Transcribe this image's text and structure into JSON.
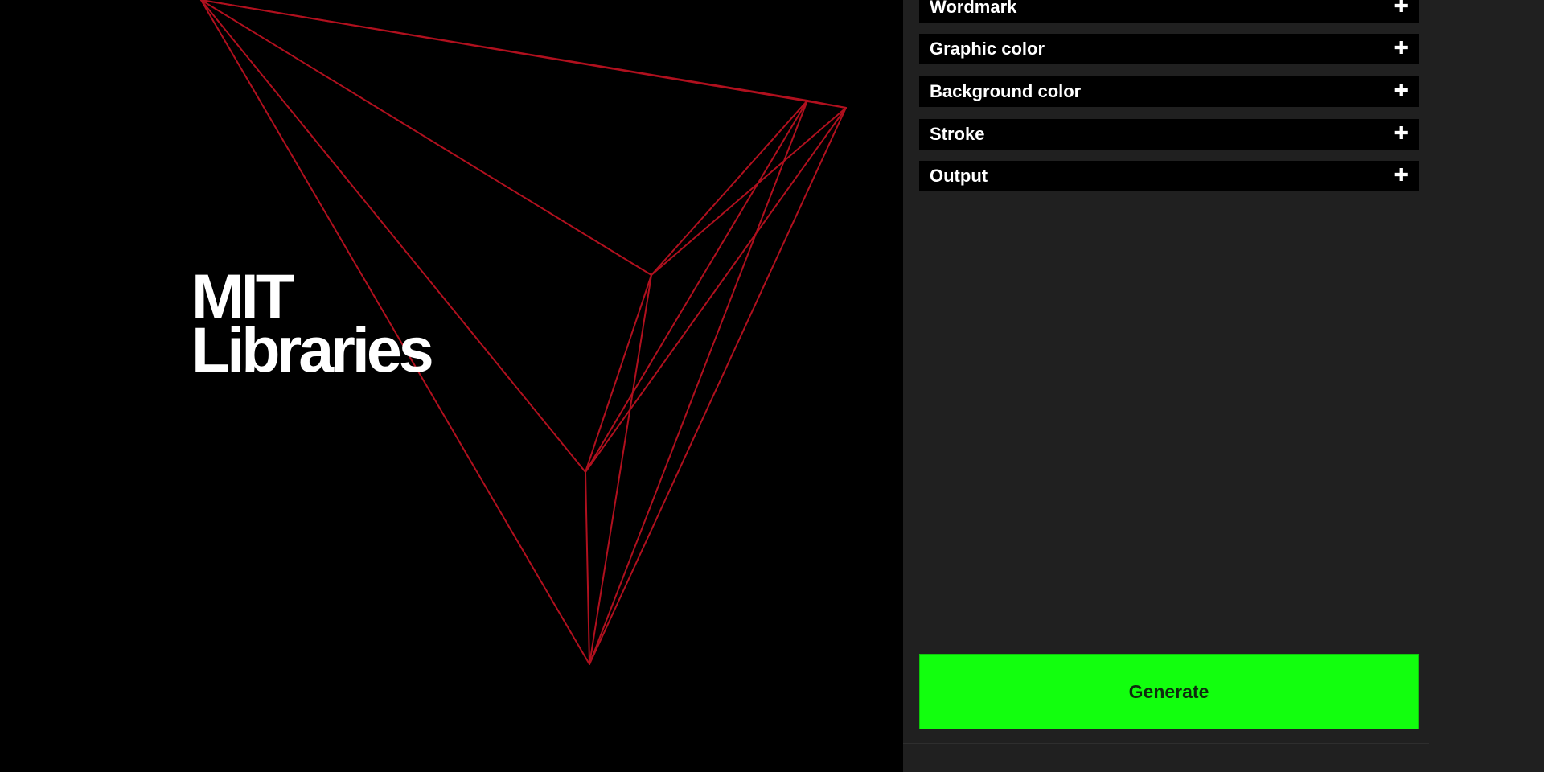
{
  "colors": {
    "canvas_background": "#000000",
    "graphic_stroke": "#b0101e",
    "panel_background": "#202020",
    "accordion_background": "#000000",
    "generate_button": "#12ff0e"
  },
  "wordmark": {
    "line1": "MIT",
    "line2": "Libraries"
  },
  "panel": {
    "sections": [
      {
        "label": "Wordmark",
        "icon": "plus-icon"
      },
      {
        "label": "Graphic color",
        "icon": "plus-icon"
      },
      {
        "label": "Background color",
        "icon": "plus-icon"
      },
      {
        "label": "Stroke",
        "icon": "plus-icon"
      },
      {
        "label": "Output",
        "icon": "plus-icon"
      }
    ],
    "generate_label": "Generate"
  }
}
